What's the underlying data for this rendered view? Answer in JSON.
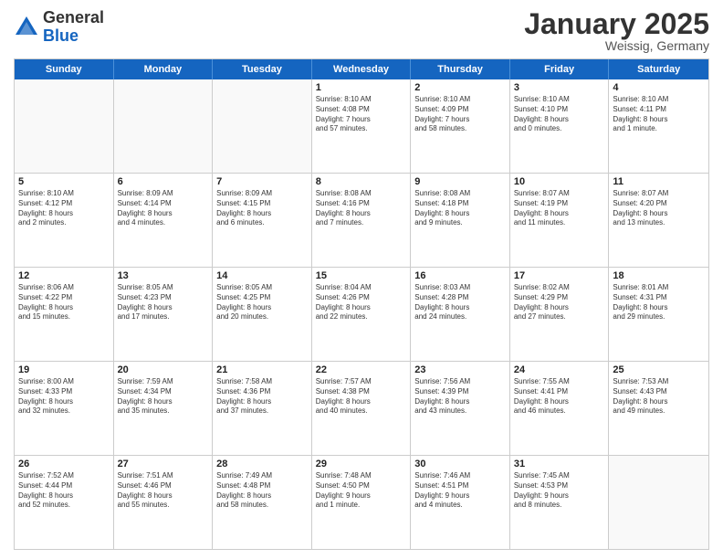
{
  "logo": {
    "general": "General",
    "blue": "Blue"
  },
  "header": {
    "month": "January 2025",
    "location": "Weissig, Germany"
  },
  "weekdays": [
    "Sunday",
    "Monday",
    "Tuesday",
    "Wednesday",
    "Thursday",
    "Friday",
    "Saturday"
  ],
  "rows": [
    [
      {
        "day": "",
        "text": "",
        "empty": true
      },
      {
        "day": "",
        "text": "",
        "empty": true
      },
      {
        "day": "",
        "text": "",
        "empty": true
      },
      {
        "day": "1",
        "text": "Sunrise: 8:10 AM\nSunset: 4:08 PM\nDaylight: 7 hours\nand 57 minutes.",
        "empty": false
      },
      {
        "day": "2",
        "text": "Sunrise: 8:10 AM\nSunset: 4:09 PM\nDaylight: 7 hours\nand 58 minutes.",
        "empty": false
      },
      {
        "day": "3",
        "text": "Sunrise: 8:10 AM\nSunset: 4:10 PM\nDaylight: 8 hours\nand 0 minutes.",
        "empty": false
      },
      {
        "day": "4",
        "text": "Sunrise: 8:10 AM\nSunset: 4:11 PM\nDaylight: 8 hours\nand 1 minute.",
        "empty": false
      }
    ],
    [
      {
        "day": "5",
        "text": "Sunrise: 8:10 AM\nSunset: 4:12 PM\nDaylight: 8 hours\nand 2 minutes.",
        "empty": false
      },
      {
        "day": "6",
        "text": "Sunrise: 8:09 AM\nSunset: 4:14 PM\nDaylight: 8 hours\nand 4 minutes.",
        "empty": false
      },
      {
        "day": "7",
        "text": "Sunrise: 8:09 AM\nSunset: 4:15 PM\nDaylight: 8 hours\nand 6 minutes.",
        "empty": false
      },
      {
        "day": "8",
        "text": "Sunrise: 8:08 AM\nSunset: 4:16 PM\nDaylight: 8 hours\nand 7 minutes.",
        "empty": false
      },
      {
        "day": "9",
        "text": "Sunrise: 8:08 AM\nSunset: 4:18 PM\nDaylight: 8 hours\nand 9 minutes.",
        "empty": false
      },
      {
        "day": "10",
        "text": "Sunrise: 8:07 AM\nSunset: 4:19 PM\nDaylight: 8 hours\nand 11 minutes.",
        "empty": false
      },
      {
        "day": "11",
        "text": "Sunrise: 8:07 AM\nSunset: 4:20 PM\nDaylight: 8 hours\nand 13 minutes.",
        "empty": false
      }
    ],
    [
      {
        "day": "12",
        "text": "Sunrise: 8:06 AM\nSunset: 4:22 PM\nDaylight: 8 hours\nand 15 minutes.",
        "empty": false
      },
      {
        "day": "13",
        "text": "Sunrise: 8:05 AM\nSunset: 4:23 PM\nDaylight: 8 hours\nand 17 minutes.",
        "empty": false
      },
      {
        "day": "14",
        "text": "Sunrise: 8:05 AM\nSunset: 4:25 PM\nDaylight: 8 hours\nand 20 minutes.",
        "empty": false
      },
      {
        "day": "15",
        "text": "Sunrise: 8:04 AM\nSunset: 4:26 PM\nDaylight: 8 hours\nand 22 minutes.",
        "empty": false
      },
      {
        "day": "16",
        "text": "Sunrise: 8:03 AM\nSunset: 4:28 PM\nDaylight: 8 hours\nand 24 minutes.",
        "empty": false
      },
      {
        "day": "17",
        "text": "Sunrise: 8:02 AM\nSunset: 4:29 PM\nDaylight: 8 hours\nand 27 minutes.",
        "empty": false
      },
      {
        "day": "18",
        "text": "Sunrise: 8:01 AM\nSunset: 4:31 PM\nDaylight: 8 hours\nand 29 minutes.",
        "empty": false
      }
    ],
    [
      {
        "day": "19",
        "text": "Sunrise: 8:00 AM\nSunset: 4:33 PM\nDaylight: 8 hours\nand 32 minutes.",
        "empty": false
      },
      {
        "day": "20",
        "text": "Sunrise: 7:59 AM\nSunset: 4:34 PM\nDaylight: 8 hours\nand 35 minutes.",
        "empty": false
      },
      {
        "day": "21",
        "text": "Sunrise: 7:58 AM\nSunset: 4:36 PM\nDaylight: 8 hours\nand 37 minutes.",
        "empty": false
      },
      {
        "day": "22",
        "text": "Sunrise: 7:57 AM\nSunset: 4:38 PM\nDaylight: 8 hours\nand 40 minutes.",
        "empty": false
      },
      {
        "day": "23",
        "text": "Sunrise: 7:56 AM\nSunset: 4:39 PM\nDaylight: 8 hours\nand 43 minutes.",
        "empty": false
      },
      {
        "day": "24",
        "text": "Sunrise: 7:55 AM\nSunset: 4:41 PM\nDaylight: 8 hours\nand 46 minutes.",
        "empty": false
      },
      {
        "day": "25",
        "text": "Sunrise: 7:53 AM\nSunset: 4:43 PM\nDaylight: 8 hours\nand 49 minutes.",
        "empty": false
      }
    ],
    [
      {
        "day": "26",
        "text": "Sunrise: 7:52 AM\nSunset: 4:44 PM\nDaylight: 8 hours\nand 52 minutes.",
        "empty": false
      },
      {
        "day": "27",
        "text": "Sunrise: 7:51 AM\nSunset: 4:46 PM\nDaylight: 8 hours\nand 55 minutes.",
        "empty": false
      },
      {
        "day": "28",
        "text": "Sunrise: 7:49 AM\nSunset: 4:48 PM\nDaylight: 8 hours\nand 58 minutes.",
        "empty": false
      },
      {
        "day": "29",
        "text": "Sunrise: 7:48 AM\nSunset: 4:50 PM\nDaylight: 9 hours\nand 1 minute.",
        "empty": false
      },
      {
        "day": "30",
        "text": "Sunrise: 7:46 AM\nSunset: 4:51 PM\nDaylight: 9 hours\nand 4 minutes.",
        "empty": false
      },
      {
        "day": "31",
        "text": "Sunrise: 7:45 AM\nSunset: 4:53 PM\nDaylight: 9 hours\nand 8 minutes.",
        "empty": false
      },
      {
        "day": "",
        "text": "",
        "empty": true
      }
    ]
  ]
}
